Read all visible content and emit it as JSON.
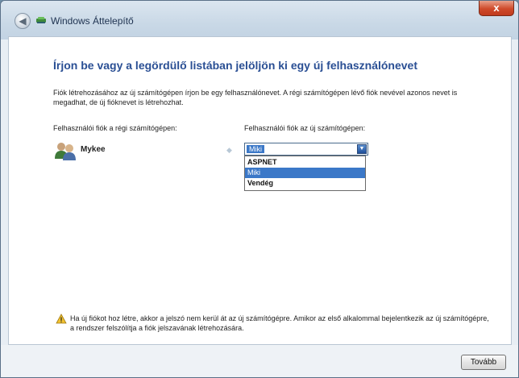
{
  "window": {
    "title": "Windows Áttelepítő",
    "close_label": "x"
  },
  "page": {
    "heading": "Írjon be vagy a legördülő listában jelöljön ki egy új felhasználónevet",
    "description": "Fiók létrehozásához az új számítógépen írjon be egy felhasználónevet. A régi számítógépen lévő fiók nevével azonos nevet is megadhat, de új fióknevet is létrehozhat.",
    "old_account_label": "Felhasználói fiók a régi számítógépen:",
    "new_account_label": "Felhasználói fiók az új számítógépen:",
    "old_user": {
      "name": "Mykee",
      "icon": "users-icon"
    },
    "combo": {
      "value": "Miki"
    },
    "dropdown_options": [
      {
        "label": "ASPNET",
        "selected": false
      },
      {
        "label": "Miki",
        "selected": true
      },
      {
        "label": "Vendég",
        "selected": false
      }
    ],
    "warning": "Ha új fiókot hoz létre, akkor a jelszó nem kerül át az új számítógépre. Amikor az első alkalommal bejelentkezik az új számítógépre, a rendszer felszólítja a fiók jelszavának létrehozására."
  },
  "footer": {
    "next_label": "Tovább"
  },
  "colors": {
    "heading": "#2a4f94",
    "selection": "#3b78c8",
    "close": "#cf4a2a"
  }
}
